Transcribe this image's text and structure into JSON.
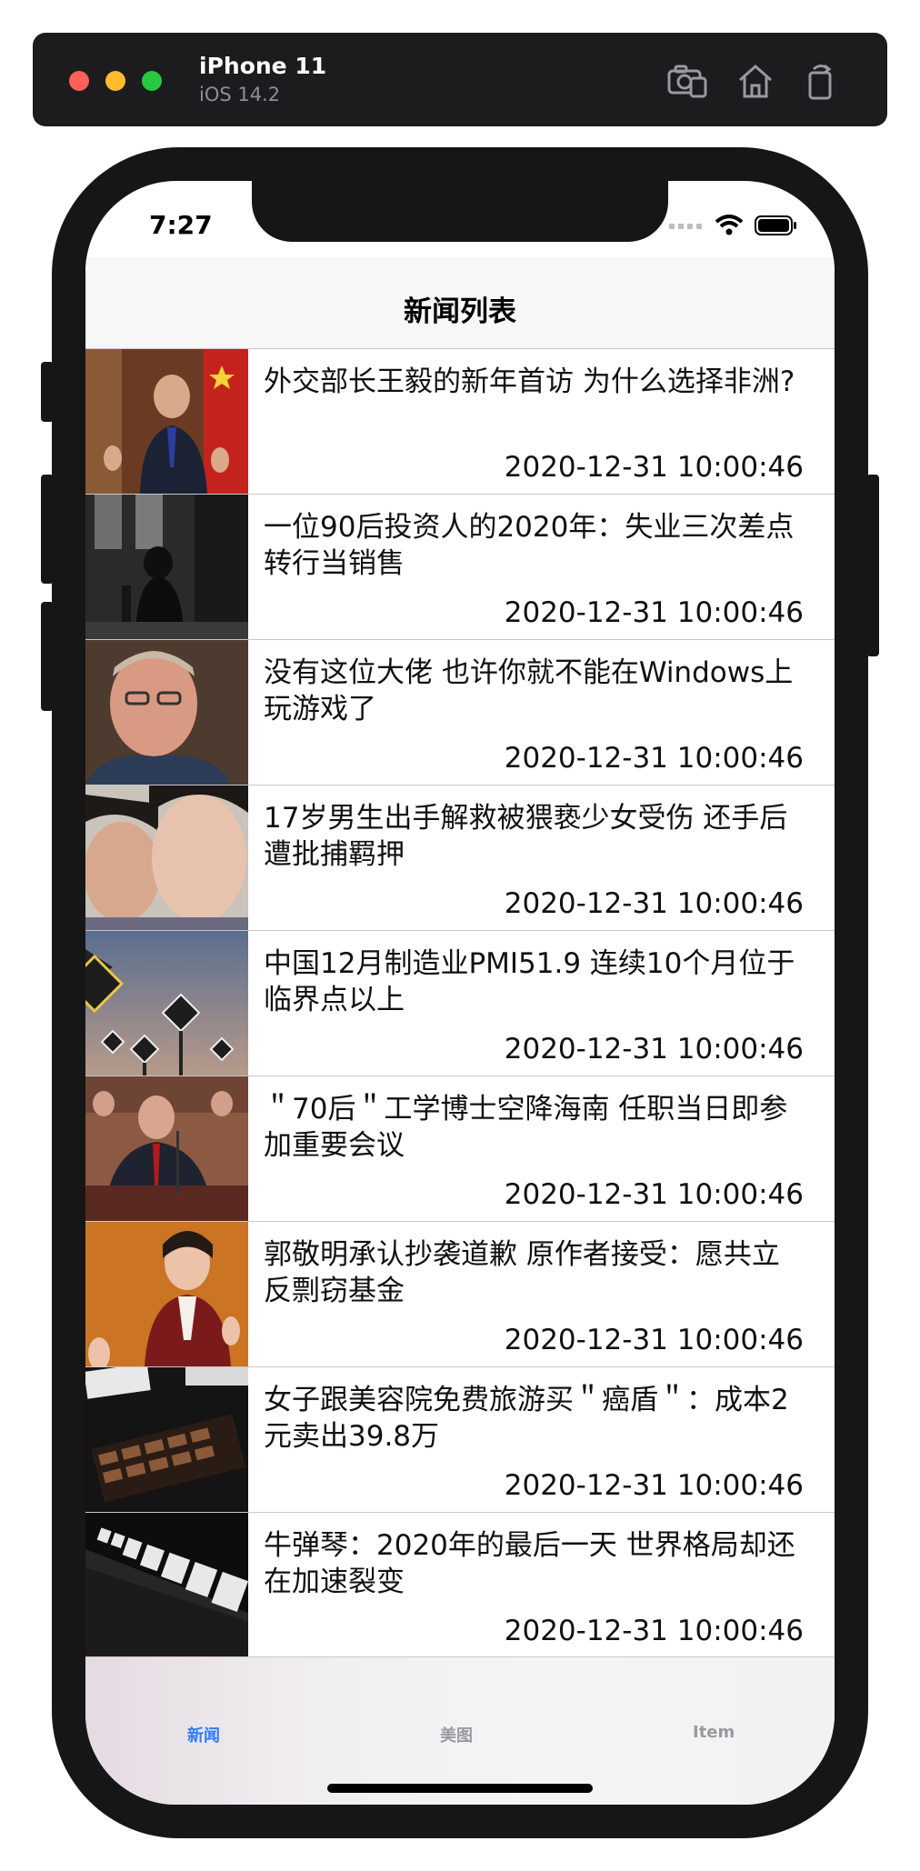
{
  "simulator": {
    "device": "iPhone 11",
    "os": "iOS 14.2",
    "icons": [
      "screenshot-icon",
      "home-icon",
      "rotate-icon"
    ]
  },
  "status_bar": {
    "time": "7:27"
  },
  "nav": {
    "title": "新闻列表"
  },
  "news": [
    {
      "title": "外交部长王毅的新年首访 为什么选择非洲?",
      "time": "2020-12-31 10:00:46"
    },
    {
      "title": "一位90后投资人的2020年：失业三次差点转行当销售",
      "time": "2020-12-31 10:00:46"
    },
    {
      "title": "没有这位大佬 也许你就不能在Windows上玩游戏了",
      "time": "2020-12-31 10:00:46"
    },
    {
      "title": "17岁男生出手解救被猥亵少女受伤 还手后遭批捕羁押",
      "time": "2020-12-31 10:00:46"
    },
    {
      "title": "中国12月制造业PMI51.9 连续10个月位于临界点以上",
      "time": "2020-12-31 10:00:46"
    },
    {
      "title": "＂70后＂工学博士空降海南 任职当日即参加重要会议",
      "time": "2020-12-31 10:00:46"
    },
    {
      "title": "郭敬明承认抄袭道歉 原作者接受：愿共立反剽窃基金",
      "time": "2020-12-31 10:00:46"
    },
    {
      "title": "女子跟美容院免费旅游买＂癌盾＂：成本2元卖出39.8万",
      "time": "2020-12-31 10:00:46"
    },
    {
      "title": "牛弹琴：2020年的最后一天 世界格局却还在加速裂变",
      "time": "2020-12-31 10:00:46"
    }
  ],
  "tabbar": {
    "tabs": [
      {
        "label": "新闻",
        "active": true
      },
      {
        "label": "美图",
        "active": false
      },
      {
        "label": "Item",
        "active": false
      }
    ]
  },
  "colors": {
    "accent": "#2f7cf6",
    "tab_inactive": "#9a9a9e",
    "separator": "#c8c8cc"
  }
}
